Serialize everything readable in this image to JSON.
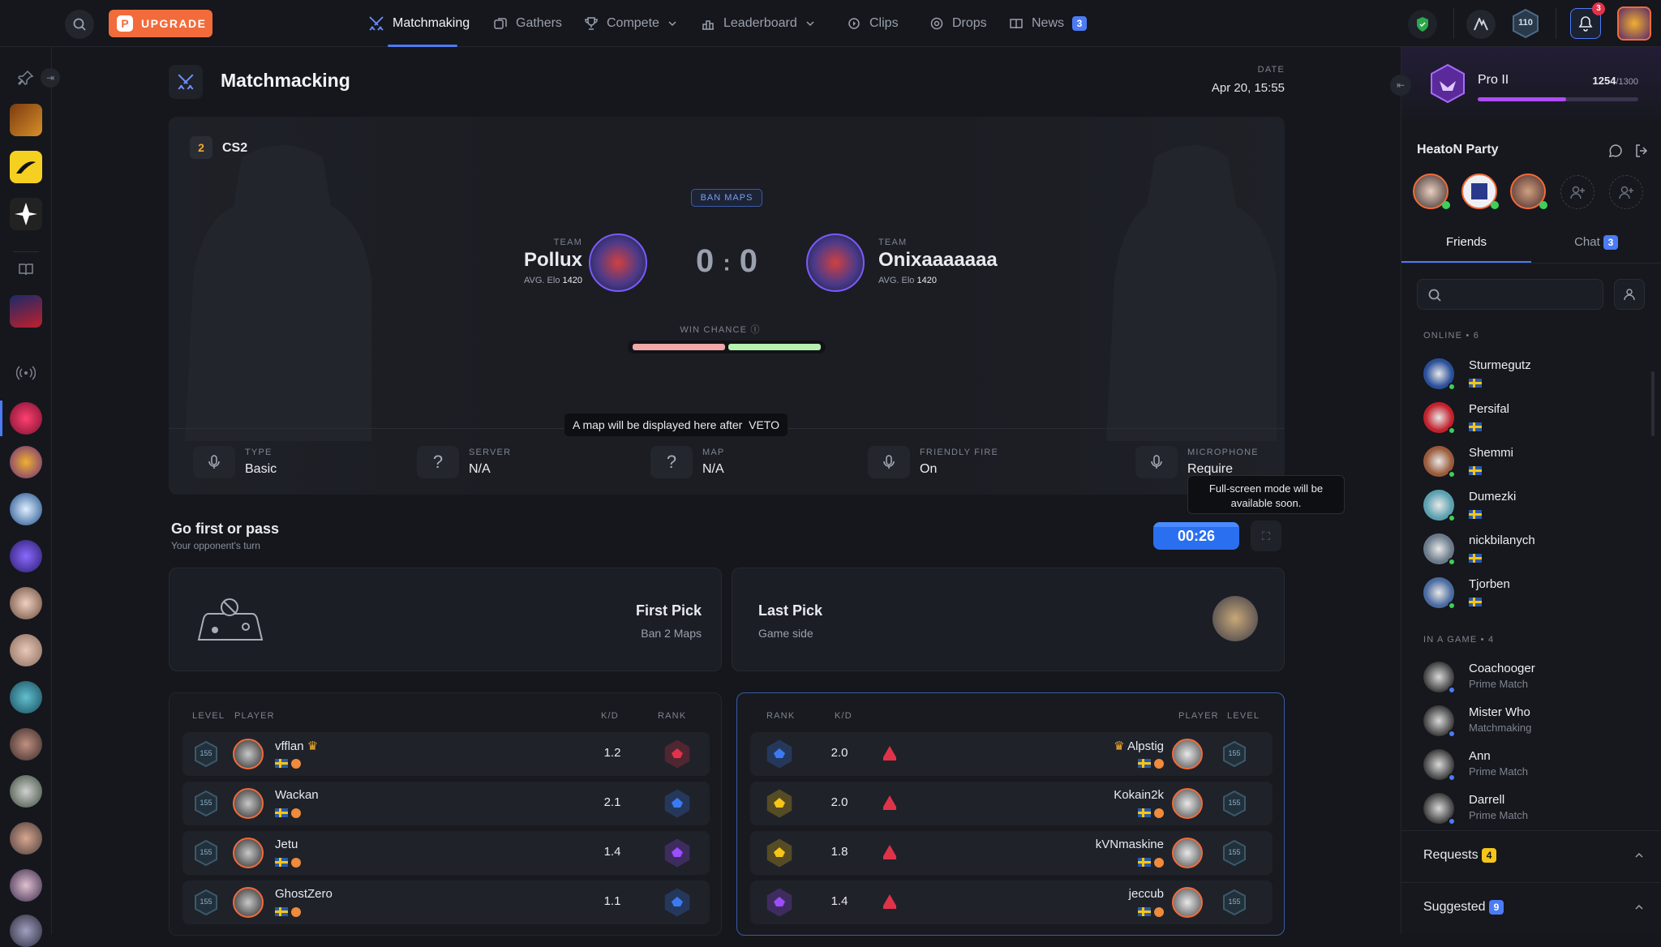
{
  "topbar": {
    "upgrade_label": "UPGRADE",
    "nav": [
      {
        "label": "Matchmaking",
        "icon": "swords-icon"
      },
      {
        "label": "Gathers",
        "icon": "gathers-icon"
      },
      {
        "label": "Compete",
        "icon": "trophy-icon"
      },
      {
        "label": "Leaderboard",
        "icon": "leaderboard-icon"
      },
      {
        "label": "Clips",
        "icon": "clips-icon"
      },
      {
        "label": "Drops",
        "icon": "drops-icon"
      },
      {
        "label": "News",
        "icon": "news-icon"
      }
    ],
    "news_badge": "3",
    "level_chip": "110",
    "notifications_badge": "3"
  },
  "page": {
    "title": "Matchmacking",
    "date_label": "DATE",
    "date_value": "Apr 20, 15:55"
  },
  "match": {
    "game": "CS2",
    "ban_maps_label": "BAN MAPS",
    "team_label": "TEAM",
    "avg_elo_label": "AVG. Elo",
    "team1": {
      "name": "Pollux",
      "elo": "1420"
    },
    "team2": {
      "name": "Onixaaaaaaa",
      "elo": "1420"
    },
    "score1": "0",
    "score_sep": ":",
    "score2": "0",
    "win_chance_label": "WIN CHANCE",
    "map_tooltip": "A map will be displayed here after  VETO",
    "info": [
      {
        "label": "TYPE",
        "value": "Basic",
        "icon": "microphone-icon"
      },
      {
        "label": "SERVER",
        "value": "N/A",
        "icon": "question-icon"
      },
      {
        "label": "MAP",
        "value": "N/A",
        "icon": "question-icon"
      },
      {
        "label": "FRIENDLY FIRE",
        "value": "On",
        "icon": "microphone-icon"
      },
      {
        "label": "MICROPHONE",
        "value": "Require",
        "icon": "microphone-icon"
      }
    ],
    "fullscreen_tooltip": "Full-screen mode will be available soon."
  },
  "veto": {
    "title": "Go first or pass",
    "subtitle": "Your opponent's turn",
    "timer": "00:26",
    "first_pick_title": "First Pick",
    "first_pick_sub": "Ban 2 Maps",
    "last_pick_title": "Last Pick",
    "last_pick_sub": "Game side"
  },
  "team1_table": {
    "headers": {
      "level": "LEVEL",
      "player": "PLAYER",
      "kd": "K/D",
      "rank": "RANK"
    },
    "rows": [
      {
        "name": "vfflan",
        "kd": "1.2",
        "level": "155",
        "crown": true,
        "rank_color": "#e0334a"
      },
      {
        "name": "Wackan",
        "kd": "2.1",
        "level": "155",
        "crown": false,
        "rank_color": "#3a7bf5"
      },
      {
        "name": "Jetu",
        "kd": "1.4",
        "level": "155",
        "crown": false,
        "rank_color": "#9b4dff"
      },
      {
        "name": "GhostZero",
        "kd": "1.1",
        "level": "155",
        "crown": false,
        "rank_color": "#3a7bf5"
      }
    ]
  },
  "team2_table": {
    "headers": {
      "rank": "RANK",
      "kd": "K/D",
      "player": "PLAYER",
      "level": "LEVEL"
    },
    "rows": [
      {
        "name": "Alpstig",
        "kd": "2.0",
        "level": "155",
        "crown": true,
        "rank_color": "#3a7bf5"
      },
      {
        "name": "Kokain2k",
        "kd": "2.0",
        "level": "155",
        "crown": false,
        "rank_color": "#f5c518"
      },
      {
        "name": "kVNmaskine",
        "kd": "1.8",
        "level": "155",
        "crown": false,
        "rank_color": "#f5c518"
      },
      {
        "name": "jeccub",
        "kd": "1.4",
        "level": "155",
        "crown": false,
        "rank_color": "#9b4dff"
      }
    ]
  },
  "profile": {
    "rank_name": "Pro II",
    "points": "1254",
    "points_max": "/1300",
    "progress_fraction": 0.55
  },
  "party": {
    "title": "HeatoN Party"
  },
  "tabs": {
    "friends": "Friends",
    "chat": "Chat",
    "chat_badge": "3"
  },
  "friends": {
    "online_header": "ONLINE • 6",
    "online": [
      {
        "name": "Sturmegutz",
        "color": "#2a4f9a"
      },
      {
        "name": "Persifal",
        "color": "#c2202c"
      },
      {
        "name": "Shemmi",
        "color": "#9a5a3a"
      },
      {
        "name": "Dumezki",
        "color": "#5aa0b0"
      },
      {
        "name": "nickbilanych",
        "color": "#6a7a8a"
      },
      {
        "name": "Tjorben",
        "color": "#4a6aa0"
      }
    ],
    "ingame_header": "IN A GAME • 4",
    "ingame": [
      {
        "name": "Coachooger",
        "status": "Prime Match"
      },
      {
        "name": "Mister Who",
        "status": "Matchmaking"
      },
      {
        "name": "Ann",
        "status": "Prime Match"
      },
      {
        "name": "Darrell",
        "status": "Prime Match"
      }
    ],
    "requests_label": "Requests",
    "requests_badge": "4",
    "suggested_label": "Suggested",
    "suggested_badge": "9"
  },
  "colors": {
    "accent": "#4b7bf5",
    "upgrade": "#f26b3a",
    "team1_bar": "#f0a8a8",
    "team2_bar": "#b8f0b0",
    "online_dot": "#3ecf5a",
    "ingame_dot": "#4b7bf5"
  }
}
